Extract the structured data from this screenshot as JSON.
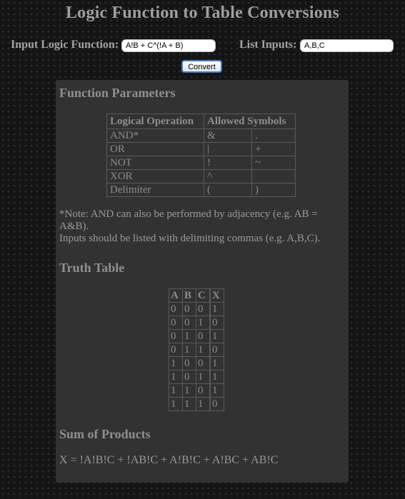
{
  "page": {
    "title": "Logic Function to Table Conversions"
  },
  "form": {
    "function_label": "Input Logic Function:",
    "function_value": "A!B + C^(!A + B)",
    "inputs_label": "List Inputs:",
    "inputs_value": "A,B,C",
    "convert_label": "Convert"
  },
  "parameters": {
    "heading": "Function Parameters",
    "columns": [
      "Logical Operation",
      "Allowed Symbols"
    ],
    "rows": [
      {
        "op": "AND*",
        "sym1": "&",
        "sym2": "."
      },
      {
        "op": "OR",
        "sym1": "|",
        "sym2": "+"
      },
      {
        "op": "NOT",
        "sym1": "!",
        "sym2": "~"
      },
      {
        "op": "XOR",
        "sym1": "^",
        "sym2": ""
      },
      {
        "op": "Delimiter",
        "sym1": "(",
        "sym2": ")"
      }
    ],
    "note_line1": "*Note: AND can also be performed by adjacency (e.g. AB = A&B).",
    "note_line2": "Inputs should be listed with delimiting commas (e.g. A,B,C)."
  },
  "truth_table": {
    "heading": "Truth Table",
    "columns": [
      "A",
      "B",
      "C",
      "X"
    ],
    "rows": [
      [
        "0",
        "0",
        "0",
        "1"
      ],
      [
        "0",
        "0",
        "1",
        "0"
      ],
      [
        "0",
        "1",
        "0",
        "1"
      ],
      [
        "0",
        "1",
        "1",
        "0"
      ],
      [
        "1",
        "0",
        "0",
        "1"
      ],
      [
        "1",
        "0",
        "1",
        "1"
      ],
      [
        "1",
        "1",
        "0",
        "1"
      ],
      [
        "1",
        "1",
        "1",
        "0"
      ]
    ]
  },
  "sum_of_products": {
    "heading": "Sum of Products",
    "expression": "X = !A!B!C + !AB!C + A!B!C + A!BC + AB!C"
  }
}
